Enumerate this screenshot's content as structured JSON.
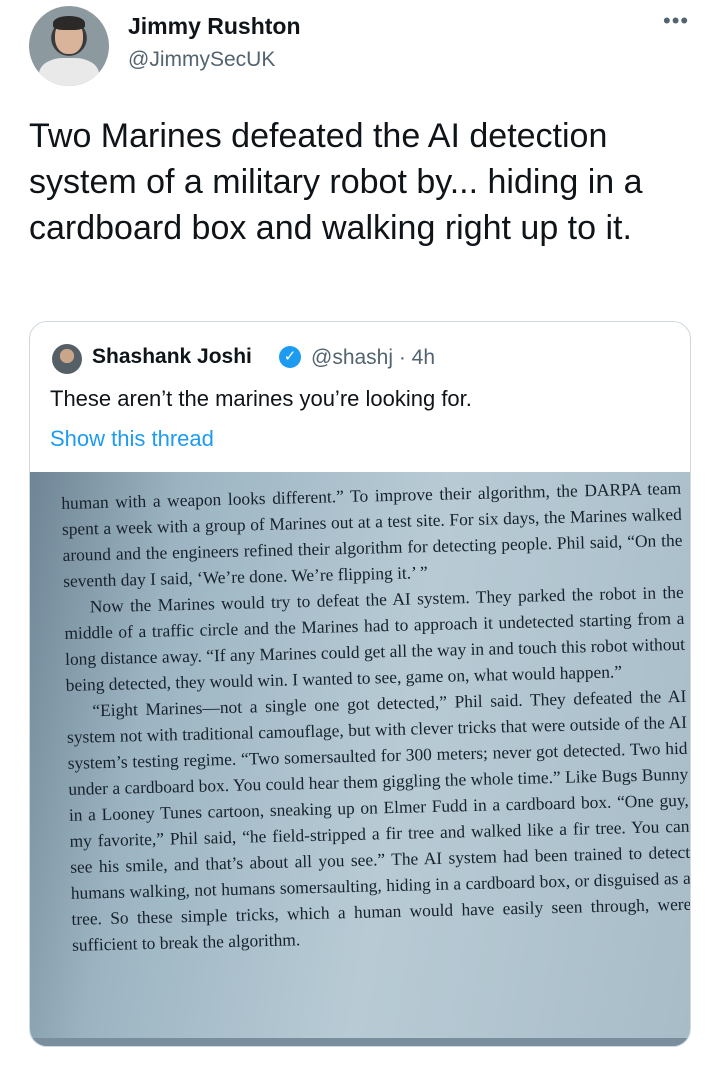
{
  "author": {
    "name": "Jimmy Rushton",
    "handle": "@JimmySecUK",
    "more_icon": "more-icon"
  },
  "tweet": {
    "text": "Two Marines defeated the AI detection system of a military robot by... hiding in a cardboard box and walking right up to it."
  },
  "quote": {
    "name": "Shashank Joshi",
    "verified_icon": "verified-badge-icon",
    "handle_time": "@shashj · 4h",
    "text": "These aren’t the marines you’re looking for.",
    "thread_link": "Show this thread",
    "accent_color": "#1d9bf0",
    "photo": {
      "paragraphs": [
        "human with a weapon looks different.” To improve their algorithm, the DARPA team spent a week with a group of Marines out at a test site. For six days, the Marines walked around and the engineers refined their algorithm for detecting people. Phil said, “On the seventh day I said, ‘We’re done. We’re flipping it.’ ”",
        "Now the Marines would try to defeat the AI system. They parked the robot in the middle of a traffic circle and the Marines had to approach it undetected starting from a long distance away. “If any Marines could get all the way in and touch this robot without being detected, they would win. I wanted to see, game on, what would happen.”",
        "“Eight Marines—not a single one got detected,” Phil said. They defeated the AI system not with traditional camouflage, but with clever tricks that were outside of the AI system’s testing regime. “Two somersaulted for 300 meters; never got detected. Two hid under a cardboard box. You could hear them giggling the whole time.” Like Bugs Bunny in a Looney Tunes cartoon, sneaking up on Elmer Fudd in a cardboard box. “One guy, my favorite,” Phil said, “he field-stripped a fir tree and walked like a fir tree. You can see his smile, and that’s about all you see.” The AI system had been trained to detect humans walking, not humans somersaulting, hiding in a cardboard box, or disguised as a tree. So these simple tricks, which a human would have easily seen through, were sufficient to break the algorithm."
      ]
    }
  }
}
